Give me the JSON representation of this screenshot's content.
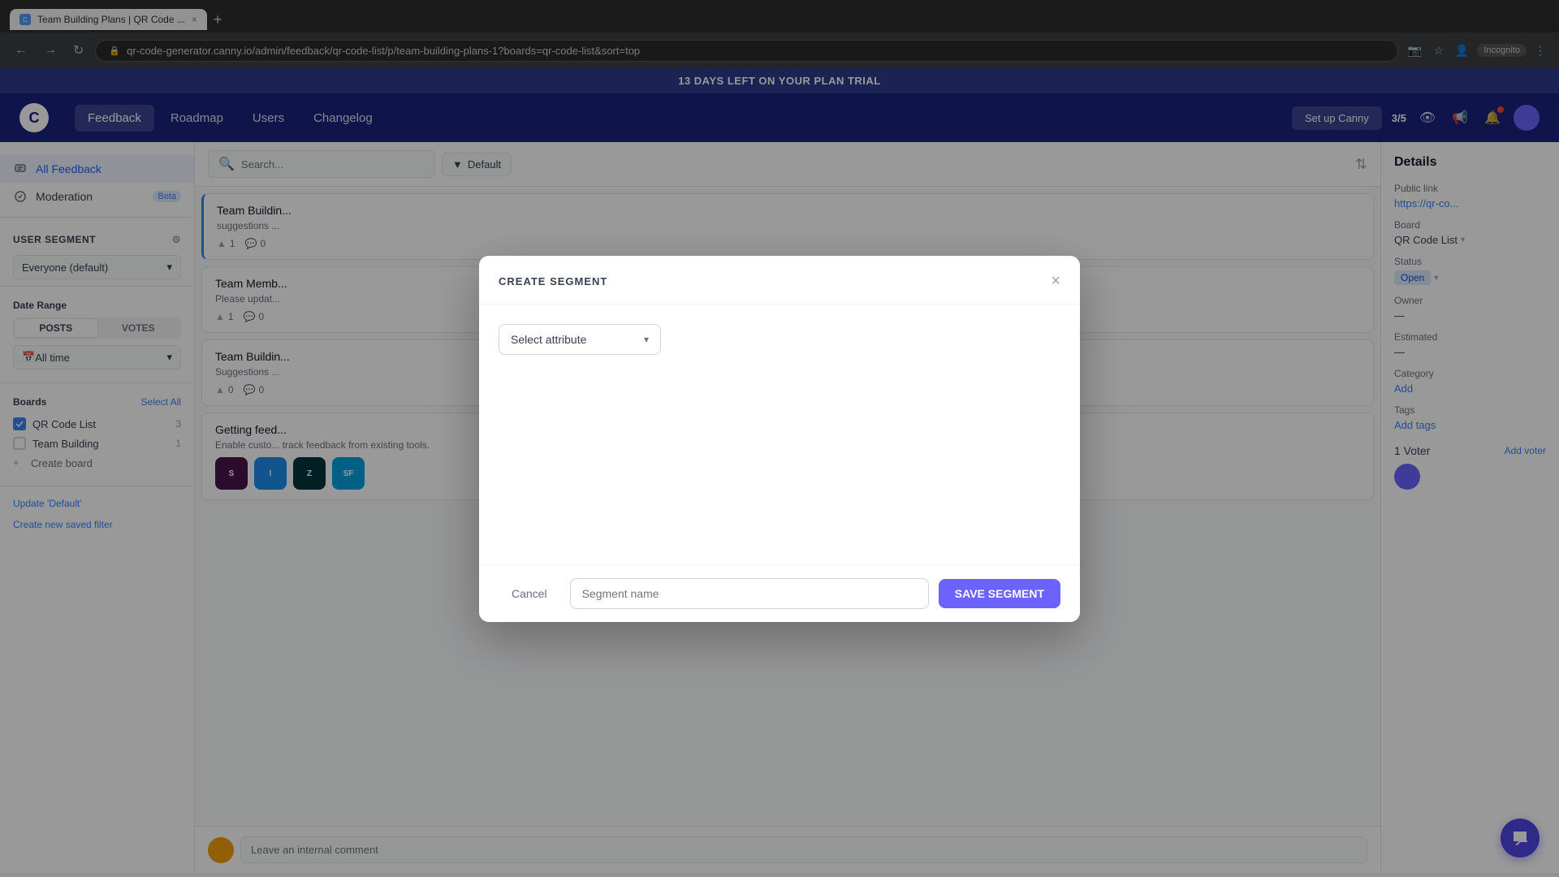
{
  "browser": {
    "tab_title": "Team Building Plans | QR Code ...",
    "address": "qr-code-generator.canny.io/admin/feedback/qr-code-list/p/team-building-plans-1?boards=qr-code-list&sort=top",
    "new_tab_icon": "+",
    "incognito_label": "Incognito",
    "back_icon": "←",
    "forward_icon": "→",
    "refresh_icon": "↻"
  },
  "trial_banner": {
    "text": "13 DAYS LEFT ON YOUR PLAN TRIAL"
  },
  "app_header": {
    "logo_text": "C",
    "nav_items": [
      {
        "label": "Feedback",
        "active": true
      },
      {
        "label": "Roadmap",
        "active": false
      },
      {
        "label": "Users",
        "active": false
      },
      {
        "label": "Changelog",
        "active": false
      }
    ],
    "setup_label": "Set up Canny",
    "progress": "3/5"
  },
  "sidebar": {
    "all_feedback_label": "All Feedback",
    "moderation_label": "Moderation",
    "moderation_badge": "Beta",
    "user_segment_label": "User Segment",
    "segment_default": "Everyone (default)",
    "date_range_label": "Date Range",
    "posts_tab": "POSTS",
    "votes_tab": "VOTES",
    "date_filter": "All time",
    "boards_label": "Boards",
    "select_all_label": "Select All",
    "boards": [
      {
        "name": "QR Code List",
        "count": 3,
        "checked": true
      },
      {
        "name": "Team Building",
        "count": 1,
        "checked": false
      }
    ],
    "create_board_label": "Create board",
    "update_filter_label": "Update 'Default'",
    "create_saved_filter_label": "Create new saved filter"
  },
  "content": {
    "search_placeholder": "Search...",
    "filter_label": "Default",
    "posts": [
      {
        "title": "Team Building",
        "subtitle": "suggestions ...",
        "votes_up": 1,
        "votes_down": 0,
        "active": true
      },
      {
        "title": "Team Memb...",
        "subtitle": "Please updat...",
        "votes_up": 1,
        "votes_down": 0,
        "active": false
      },
      {
        "title": "Team Buildin...",
        "subtitle": "Suggestions ...",
        "votes_up": 0,
        "votes_down": 0,
        "active": false
      },
      {
        "title": "Getting feed...",
        "subtitle": "Enable custo... track feedback from existing tools.",
        "votes_up": 0,
        "votes_down": 0,
        "active": false
      }
    ],
    "comment_placeholder": "Leave an internal comment"
  },
  "right_panel": {
    "title": "Details",
    "public_link_label": "Public link",
    "public_link_text": "https://qr-co...",
    "board_label": "Board",
    "board_value": "QR Code List",
    "status_label": "Status",
    "status_value": "Open",
    "owner_label": "Owner",
    "owner_value": "—",
    "estimated_label": "Estimated",
    "estimated_value": "—",
    "category_label": "Category",
    "category_value": "Add",
    "tags_label": "Tags",
    "tags_value": "Add tags",
    "voter_count_label": "1 Voter",
    "add_voter_label": "Add voter"
  },
  "modal": {
    "title": "CREATE SEGMENT",
    "select_attribute_label": "Select attribute",
    "cancel_label": "Cancel",
    "segment_name_placeholder": "Segment name",
    "save_button_label": "SAVE SEGMENT",
    "close_icon": "×"
  },
  "integrations": [
    {
      "name": "Slack",
      "color": "#4a154b",
      "letter": "S"
    },
    {
      "name": "Intercom",
      "color": "#1f8ded",
      "letter": "I"
    },
    {
      "name": "Zendesk",
      "color": "#03363d",
      "letter": "Z"
    },
    {
      "name": "Salesforce",
      "color": "#00a1e0",
      "letter": "SF"
    }
  ]
}
